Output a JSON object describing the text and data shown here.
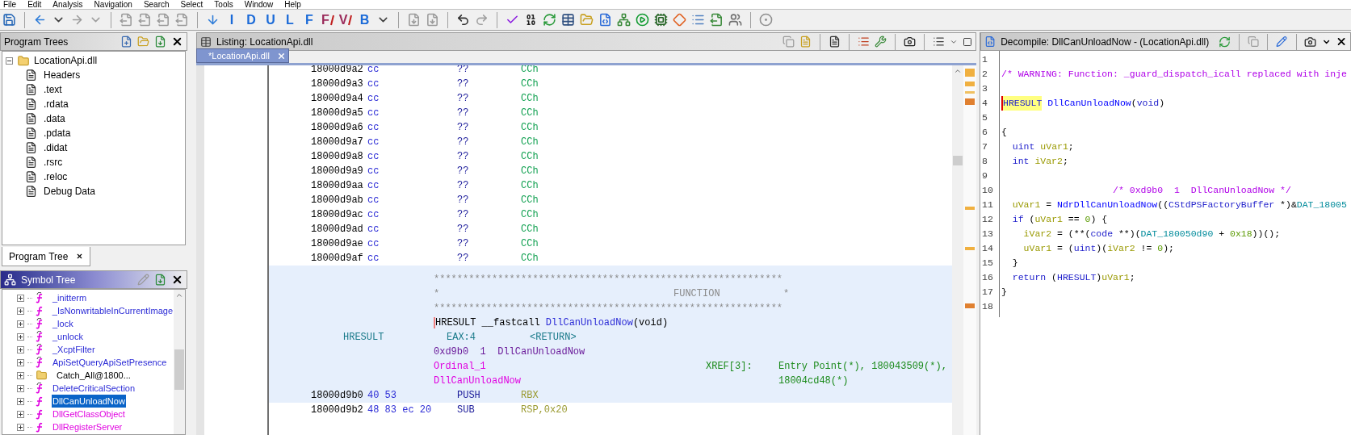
{
  "menu": [
    "File",
    "Edit",
    "Analysis",
    "Navigation",
    "Search",
    "Select",
    "Tools",
    "Window",
    "Help"
  ],
  "toolbar": {
    "letter_buttons": [
      {
        "label": "I",
        "struck": false
      },
      {
        "label": "D",
        "struck": false
      },
      {
        "label": "U",
        "struck": false
      },
      {
        "label": "L",
        "struck": false
      },
      {
        "label": "F",
        "struck": false
      },
      {
        "label": "F",
        "struck": true
      },
      {
        "label": "V",
        "struck": true
      },
      {
        "label": "B",
        "struck": false
      }
    ]
  },
  "program_trees": {
    "title": "Program Trees",
    "root": {
      "label": "LocationApi.dll",
      "expanded": true,
      "children": [
        {
          "label": "Headers"
        },
        {
          "label": ".text"
        },
        {
          "label": ".rdata"
        },
        {
          "label": ".data"
        },
        {
          "label": ".pdata"
        },
        {
          "label": ".didat"
        },
        {
          "label": ".rsrc"
        },
        {
          "label": ".reloc"
        },
        {
          "label": "Debug Data"
        }
      ]
    },
    "tabs": [
      {
        "label": "Program Tree",
        "selected": true
      }
    ]
  },
  "symbol_tree": {
    "title": "Symbol Tree",
    "items": [
      {
        "label": "_initterm",
        "kind": "thunk",
        "color": "#2b2bd6",
        "expanded": false,
        "selected": false
      },
      {
        "label": "_IsNonwritableInCurrentImage",
        "kind": "function",
        "color": "#2b2bd6",
        "expanded": false,
        "selected": false
      },
      {
        "label": "_lock",
        "kind": "thunk",
        "color": "#2b2bd6",
        "expanded": false,
        "selected": false
      },
      {
        "label": "_unlock",
        "kind": "thunk",
        "color": "#2b2bd6",
        "expanded": false,
        "selected": false
      },
      {
        "label": "_XcptFilter",
        "kind": "thunk",
        "color": "#2b2bd6",
        "expanded": false,
        "selected": false
      },
      {
        "label": "ApiSetQueryApiSetPresence",
        "kind": "thunk",
        "color": "#2b2bd6",
        "expanded": false,
        "selected": false
      },
      {
        "label": "Catch_All@1800...",
        "kind": "folder",
        "color": "#000000",
        "expanded": false,
        "selected": false
      },
      {
        "label": "DeleteCriticalSection",
        "kind": "thunk",
        "color": "#2b2bd6",
        "expanded": false,
        "selected": false
      },
      {
        "label": "DllCanUnloadNow",
        "kind": "function",
        "color": "#e000e0",
        "expanded": false,
        "selected": true
      },
      {
        "label": "DllGetClassObject",
        "kind": "function",
        "color": "#e000e0",
        "expanded": false,
        "selected": false
      },
      {
        "label": "DllRegisterServer",
        "kind": "function",
        "color": "#e000e0",
        "expanded": false,
        "selected": false
      }
    ]
  },
  "listing": {
    "title": "Listing:  LocationApi.dll",
    "tabs": [
      {
        "label": "*LocationApi.dll",
        "selected": true
      }
    ],
    "rows": [
      {
        "address": "18000d9a2",
        "bytes": "cc",
        "mnemonic": "??",
        "operand": "CCh"
      },
      {
        "address": "18000d9a3",
        "bytes": "cc",
        "mnemonic": "??",
        "operand": "CCh"
      },
      {
        "address": "18000d9a4",
        "bytes": "cc",
        "mnemonic": "??",
        "operand": "CCh"
      },
      {
        "address": "18000d9a5",
        "bytes": "cc",
        "mnemonic": "??",
        "operand": "CCh"
      },
      {
        "address": "18000d9a6",
        "bytes": "cc",
        "mnemonic": "??",
        "operand": "CCh"
      },
      {
        "address": "18000d9a7",
        "bytes": "cc",
        "mnemonic": "??",
        "operand": "CCh"
      },
      {
        "address": "18000d9a8",
        "bytes": "cc",
        "mnemonic": "??",
        "operand": "CCh"
      },
      {
        "address": "18000d9a9",
        "bytes": "cc",
        "mnemonic": "??",
        "operand": "CCh"
      },
      {
        "address": "18000d9aa",
        "bytes": "cc",
        "mnemonic": "??",
        "operand": "CCh"
      },
      {
        "address": "18000d9ab",
        "bytes": "cc",
        "mnemonic": "??",
        "operand": "CCh"
      },
      {
        "address": "18000d9ac",
        "bytes": "cc",
        "mnemonic": "??",
        "operand": "CCh"
      },
      {
        "address": "18000d9ad",
        "bytes": "cc",
        "mnemonic": "??",
        "operand": "CCh"
      },
      {
        "address": "18000d9ae",
        "bytes": "cc",
        "mnemonic": "??",
        "operand": "CCh"
      },
      {
        "address": "18000d9af",
        "bytes": "cc",
        "mnemonic": "??",
        "operand": "CCh"
      }
    ],
    "function_header": {
      "border_lines": [
        "************************************************************",
        "************************************************************"
      ],
      "edges": [
        "*",
        "*"
      ],
      "title": "FUNCTION",
      "return_type": "HRESULT",
      "convention": " __fastcall ",
      "name": "DllCanUnloadNow",
      "params": "(void)",
      "return_row": [
        "HRESULT",
        "EAX:4",
        "<RETURN>"
      ],
      "comment": "0xd9b0  1  DllCanUnloadNow",
      "labels": [
        "Ordinal_1",
        "DllCanUnloadNow"
      ],
      "xref_label": "XREF[3]:",
      "xrefs": [
        "Entry Point(*), 180043509(*),",
        "18004cd48(*)"
      ]
    },
    "instructions": [
      {
        "address": "18000d9b0",
        "bytes": "40 53",
        "mnemonic": "PUSH",
        "operand": "RBX",
        "highlighted": true
      },
      {
        "address": "18000d9b2",
        "bytes": "48 83 ec 20",
        "mnemonic": "SUB",
        "operand": "RSP,0x20",
        "highlighted": false
      }
    ]
  },
  "decompile": {
    "title": "Decompile: DllCanUnloadNow -  (LocationApi.dll)",
    "lines": [
      {
        "number": "1"
      },
      {
        "number": "2",
        "tokens": [
          {
            "text": "/* WARNING: Function: _guard_dispatch_icall replaced with inje",
            "kind": "comment"
          }
        ]
      },
      {
        "number": "3"
      },
      {
        "number": "4",
        "tokens": [
          {
            "text": "HRESULT",
            "kind": "type",
            "highlighted": true
          },
          {
            "text": " DllCanUnloadNow",
            "kind": "func"
          },
          {
            "text": "(",
            "kind": "plain"
          },
          {
            "text": "void",
            "kind": "type"
          },
          {
            "text": ")",
            "kind": "plain"
          }
        ]
      },
      {
        "number": "5"
      },
      {
        "number": "6",
        "tokens": [
          {
            "text": "{",
            "kind": "plain"
          }
        ]
      },
      {
        "number": "7",
        "tokens": [
          {
            "text": "  uint",
            "kind": "type"
          },
          {
            "text": " uVar1",
            "kind": "var"
          },
          {
            "text": ";",
            "kind": "plain"
          }
        ]
      },
      {
        "number": "8",
        "tokens": [
          {
            "text": "  int",
            "kind": "type"
          },
          {
            "text": " iVar2",
            "kind": "var"
          },
          {
            "text": ";",
            "kind": "plain"
          }
        ]
      },
      {
        "number": "9"
      },
      {
        "number": "10",
        "tokens": [
          {
            "text": "                    /* 0xd9b0  1  DllCanUnloadNow */",
            "kind": "comment"
          }
        ]
      },
      {
        "number": "11",
        "tokens": [
          {
            "text": "  uVar1",
            "kind": "var"
          },
          {
            "text": " = ",
            "kind": "plain"
          },
          {
            "text": "NdrDllCanUnloadNow",
            "kind": "func"
          },
          {
            "text": "((",
            "kind": "plain"
          },
          {
            "text": "CStdPSFactoryBuffer",
            "kind": "type"
          },
          {
            "text": " *)&",
            "kind": "plain"
          },
          {
            "text": "DAT_18005",
            "kind": "global"
          }
        ]
      },
      {
        "number": "12",
        "tokens": [
          {
            "text": "  if",
            "kind": "keyword"
          },
          {
            "text": " (",
            "kind": "plain"
          },
          {
            "text": "uVar1",
            "kind": "var"
          },
          {
            "text": " == ",
            "kind": "plain"
          },
          {
            "text": "0",
            "kind": "const"
          },
          {
            "text": ") {",
            "kind": "plain"
          }
        ]
      },
      {
        "number": "13",
        "tokens": [
          {
            "text": "    iVar2",
            "kind": "var"
          },
          {
            "text": " = (**(",
            "kind": "plain"
          },
          {
            "text": "code",
            "kind": "type"
          },
          {
            "text": " **)(",
            "kind": "plain"
          },
          {
            "text": "DAT_180050d90",
            "kind": "global"
          },
          {
            "text": " + ",
            "kind": "plain"
          },
          {
            "text": "0x18",
            "kind": "const"
          },
          {
            "text": "))();",
            "kind": "plain"
          }
        ]
      },
      {
        "number": "14",
        "tokens": [
          {
            "text": "    uVar1",
            "kind": "var"
          },
          {
            "text": " = (",
            "kind": "plain"
          },
          {
            "text": "uint",
            "kind": "type"
          },
          {
            "text": ")(",
            "kind": "plain"
          },
          {
            "text": "iVar2",
            "kind": "var"
          },
          {
            "text": " != ",
            "kind": "plain"
          },
          {
            "text": "0",
            "kind": "const"
          },
          {
            "text": ");",
            "kind": "plain"
          }
        ]
      },
      {
        "number": "15",
        "tokens": [
          {
            "text": "  }",
            "kind": "plain"
          }
        ]
      },
      {
        "number": "16",
        "tokens": [
          {
            "text": "  return",
            "kind": "keyword"
          },
          {
            "text": " (",
            "kind": "plain"
          },
          {
            "text": "HRESULT",
            "kind": "type"
          },
          {
            "text": ")",
            "kind": "plain"
          },
          {
            "text": "uVar1",
            "kind": "var"
          },
          {
            "text": ";",
            "kind": "plain"
          }
        ]
      },
      {
        "number": "17",
        "tokens": [
          {
            "text": "}",
            "kind": "plain"
          }
        ]
      },
      {
        "number": "18"
      }
    ]
  }
}
